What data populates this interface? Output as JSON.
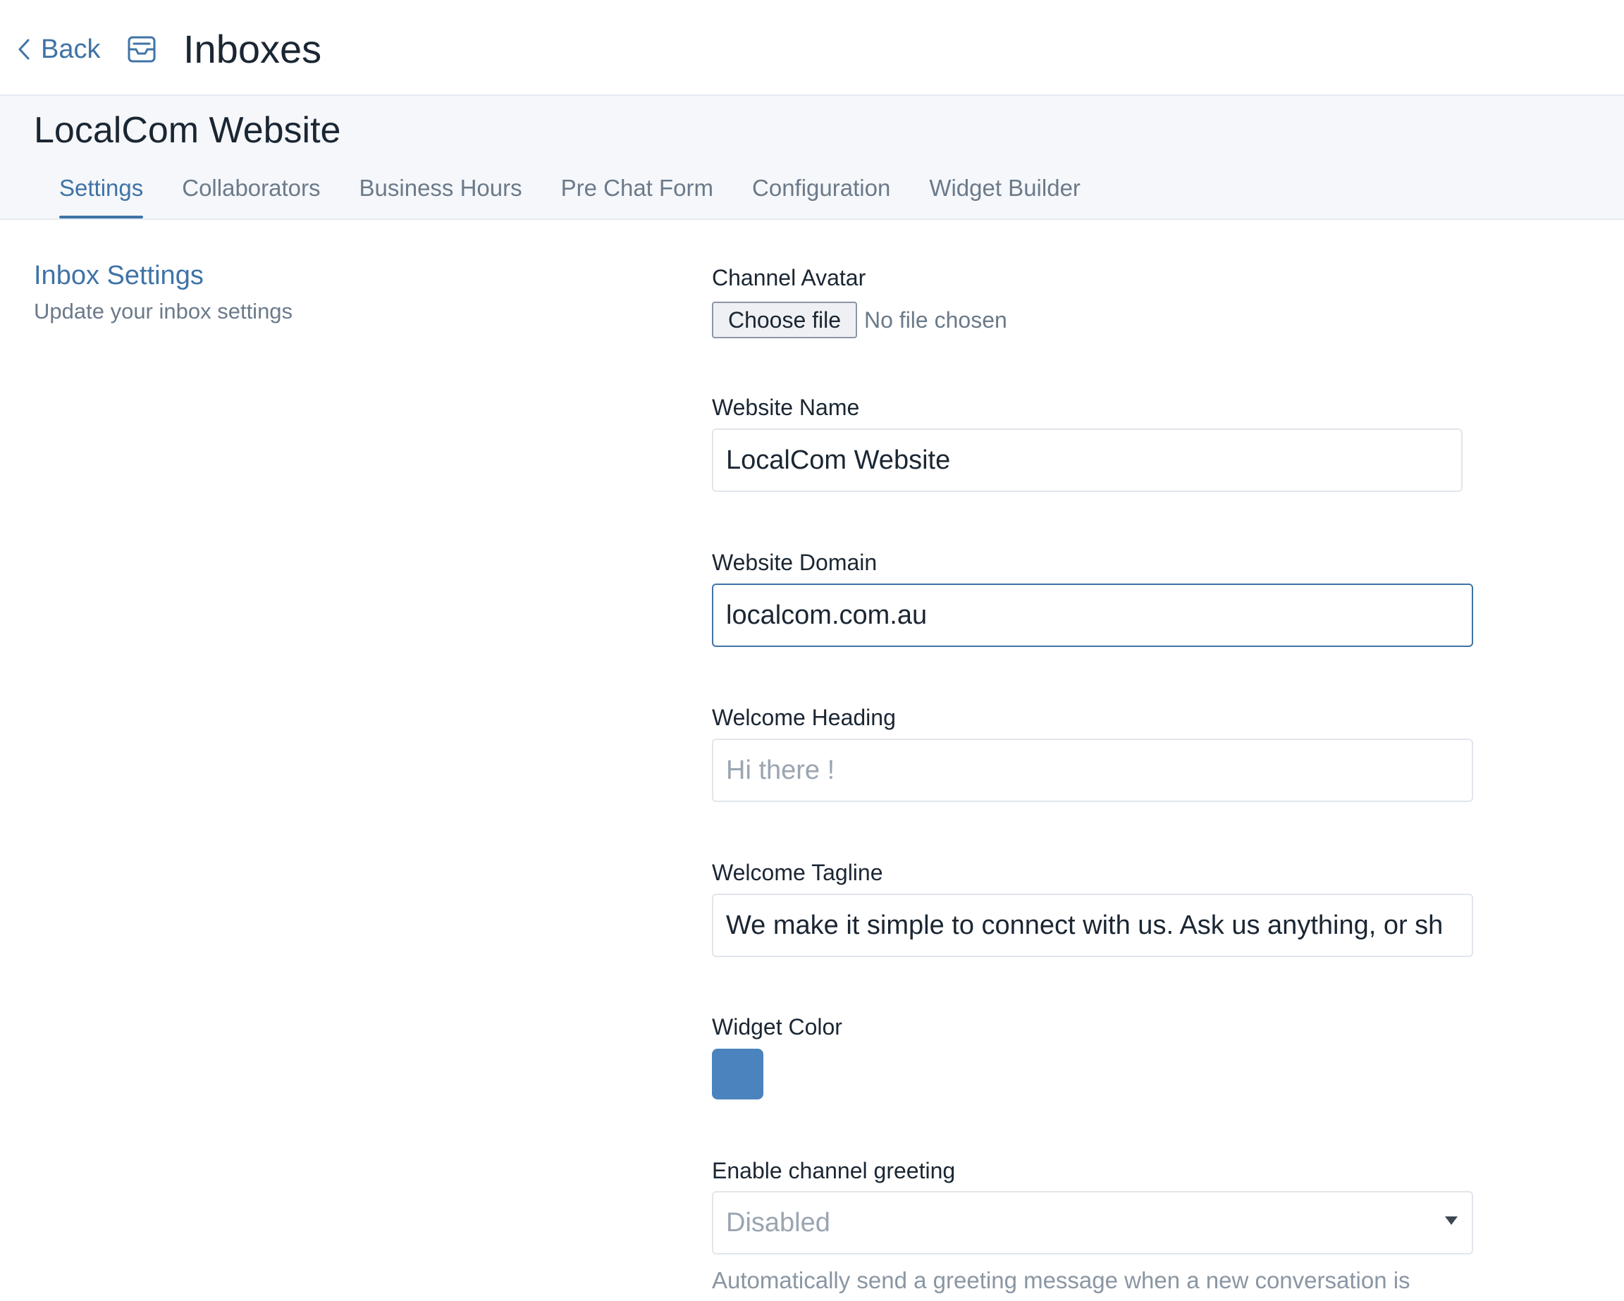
{
  "header": {
    "back_label": "Back",
    "title": "Inboxes"
  },
  "inbox": {
    "name": "LocalCom Website",
    "tabs": [
      {
        "label": "Settings",
        "active": true
      },
      {
        "label": "Collaborators",
        "active": false
      },
      {
        "label": "Business Hours",
        "active": false
      },
      {
        "label": "Pre Chat Form",
        "active": false
      },
      {
        "label": "Configuration",
        "active": false
      },
      {
        "label": "Widget Builder",
        "active": false
      }
    ]
  },
  "section": {
    "title": "Inbox Settings",
    "subtitle": "Update your inbox settings"
  },
  "form": {
    "channel_avatar": {
      "label": "Channel Avatar",
      "button": "Choose file",
      "status": "No file chosen"
    },
    "website_name": {
      "label": "Website Name",
      "value": "LocalCom Website"
    },
    "website_domain": {
      "label": "Website Domain",
      "value": "localcom.com.au"
    },
    "welcome_heading": {
      "label": "Welcome Heading",
      "value": "",
      "placeholder": "Hi there !"
    },
    "welcome_tagline": {
      "label": "Welcome Tagline",
      "value": "We make it simple to connect with us. Ask us anything, or sh"
    },
    "widget_color": {
      "label": "Widget Color",
      "color": "#4a83bd"
    },
    "channel_greeting": {
      "label": "Enable channel greeting",
      "selected": "Disabled",
      "help": "Automatically send a greeting message when a new conversation is"
    }
  },
  "colors": {
    "accent": "#3f73a6",
    "widget": "#4a83bd"
  }
}
